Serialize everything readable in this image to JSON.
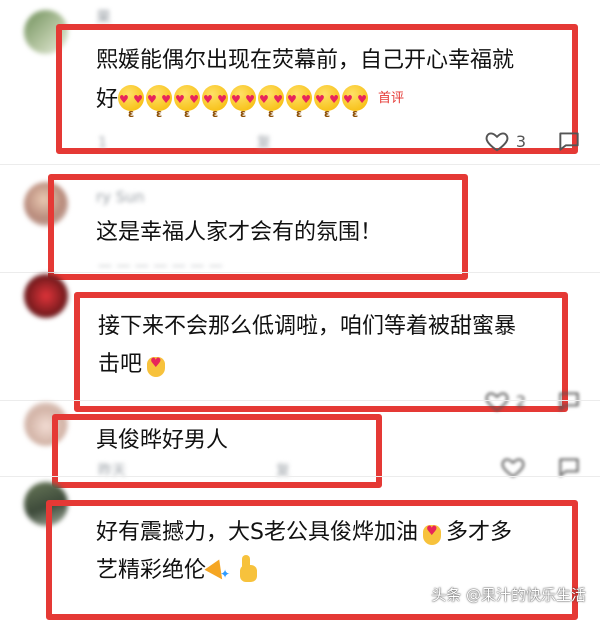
{
  "comments": [
    {
      "username": "果",
      "text_line1": "熙媛能偶尔出现在荧幕前，自己开心幸福就",
      "text_line2": "好",
      "kiss_emoji_count": 9,
      "badge": "首评",
      "meta": "1",
      "meta_tail": "复",
      "like_count": "3"
    },
    {
      "username": "ry Sun",
      "text_line1": "这是幸福人家才会有的氛围！",
      "meta": "",
      "like_count": ""
    },
    {
      "username": "",
      "text_line1": "接下来不会那么低调啦，咱们等着被甜蜜暴",
      "text_line2": "击吧",
      "meta": "",
      "like_count": "2"
    },
    {
      "username": "",
      "text_line1": "具俊晔好男人",
      "meta": "昨天",
      "meta_tail": "复",
      "like_count": ""
    },
    {
      "username": "",
      "text_line1": "好有震撼力，大S老公具俊烨加油",
      "text_line1_tail": "多才多",
      "text_line2": "艺精彩绝伦",
      "meta": "",
      "like_count": ""
    }
  ],
  "watermark": "头条 @果汁的快乐生活",
  "colors": {
    "highlight": "#e53935",
    "badge": "#e53935",
    "meta": "#9aa0a6"
  },
  "icons": {
    "like": "heart-outline-icon",
    "reply": "comment-bubble-icon"
  }
}
